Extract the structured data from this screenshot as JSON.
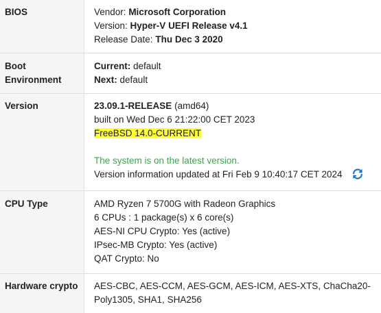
{
  "bios": {
    "label": "BIOS",
    "vendor_label": "Vendor:",
    "vendor": "Microsoft Corporation",
    "version_label": "Version:",
    "version": "Hyper-V UEFI Release v4.1",
    "date_label": "Release Date:",
    "date": "Thu Dec 3 2020"
  },
  "boot": {
    "label_line1": "Boot",
    "label_line2": "Environment",
    "current_label": "Current:",
    "current": "default",
    "next_label": "Next:",
    "next": "default"
  },
  "version": {
    "label": "Version",
    "release": "23.09.1-RELEASE",
    "arch": "(amd64)",
    "built": "built on Wed Dec 6 21:22:00 CET 2023",
    "freebsd": "FreeBSD 14.0-CURRENT",
    "status": "The system is on the latest version.",
    "updated": "Version information updated at Fri Feb 9 10:40:17 CET 2024",
    "refresh_icon": "refresh-icon",
    "highlight_color": "#ffff33",
    "status_color": "#3fa34d",
    "icon_color": "#1e73c8"
  },
  "cpu": {
    "label": "CPU Type",
    "model": "AMD Ryzen 7 5700G with Radeon Graphics",
    "cores": "6 CPUs : 1 package(s) x 6 core(s)",
    "aesni": "AES-NI CPU Crypto: Yes (active)",
    "ipsec": "IPsec-MB Crypto: Yes (active)",
    "qat": "QAT Crypto: No"
  },
  "hw_crypto": {
    "label": "Hardware crypto",
    "value": "AES-CBC, AES-CCM, AES-GCM, AES-ICM, AES-XTS, ChaCha20-Poly1305, SHA1, SHA256"
  }
}
